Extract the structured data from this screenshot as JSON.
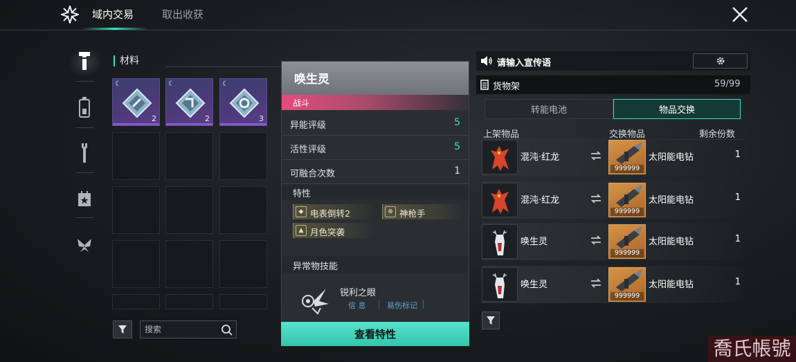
{
  "header": {
    "tabs": [
      {
        "label": "域内交易",
        "active": true
      },
      {
        "label": "取出收获",
        "active": false
      }
    ],
    "accent_color": "#38e2c6"
  },
  "sidebar": {
    "items": [
      {
        "icon": "hammer-icon",
        "active": true
      },
      {
        "icon": "battery-icon",
        "active": false
      },
      {
        "icon": "wrench-icon",
        "active": false
      },
      {
        "icon": "calendar-star-icon",
        "active": false
      },
      {
        "icon": "butterfly-icon",
        "active": false
      }
    ]
  },
  "materials": {
    "title": "材料",
    "items": [
      {
        "qty": "2"
      },
      {
        "qty": "2"
      },
      {
        "qty": "3"
      }
    ],
    "search_placeholder": "搜索"
  },
  "detail": {
    "name": "唤生灵",
    "tag": "战斗",
    "stats": [
      {
        "label": "异能评级",
        "value": "5",
        "color": "#38e2c6"
      },
      {
        "label": "活性评级",
        "value": "5",
        "color": "#38e2c6"
      },
      {
        "label": "可融合次数",
        "value": "1",
        "color": "#e0e4e8"
      }
    ],
    "traits_title": "特性",
    "traits": [
      "电表倒转2",
      "神枪手",
      "月色突袭"
    ],
    "skills_title": "异常物技能",
    "skill": {
      "name": "锐利之眼",
      "links": [
        "信 息",
        "易伤标记"
      ]
    },
    "view_button": "查看特性"
  },
  "shop": {
    "promo_text": "请输入宣传语",
    "shelf_title": "货物架",
    "shelf_count": "59/99",
    "segments": [
      {
        "label": "转能电池",
        "active": false
      },
      {
        "label": "物品交换",
        "active": true
      }
    ],
    "columns": [
      "上架物品",
      "交换物品",
      "剩余份数"
    ],
    "rows": [
      {
        "item": "混沌·红龙",
        "item_icon": "red-dragon-icon",
        "exchange": "太阳能电钻",
        "exchange_qty": "999999",
        "remaining": "1"
      },
      {
        "item": "混沌·红龙",
        "item_icon": "red-dragon-icon",
        "exchange": "太阳能电钻",
        "exchange_qty": "999999",
        "remaining": "1"
      },
      {
        "item": "唤生灵",
        "item_icon": "white-deer-icon",
        "exchange": "太阳能电钻",
        "exchange_qty": "999999",
        "remaining": "1"
      },
      {
        "item": "唤生灵",
        "item_icon": "white-deer-icon",
        "exchange": "太阳能电钻",
        "exchange_qty": "999999",
        "remaining": "1"
      }
    ]
  },
  "watermark": "喬氏帳號"
}
